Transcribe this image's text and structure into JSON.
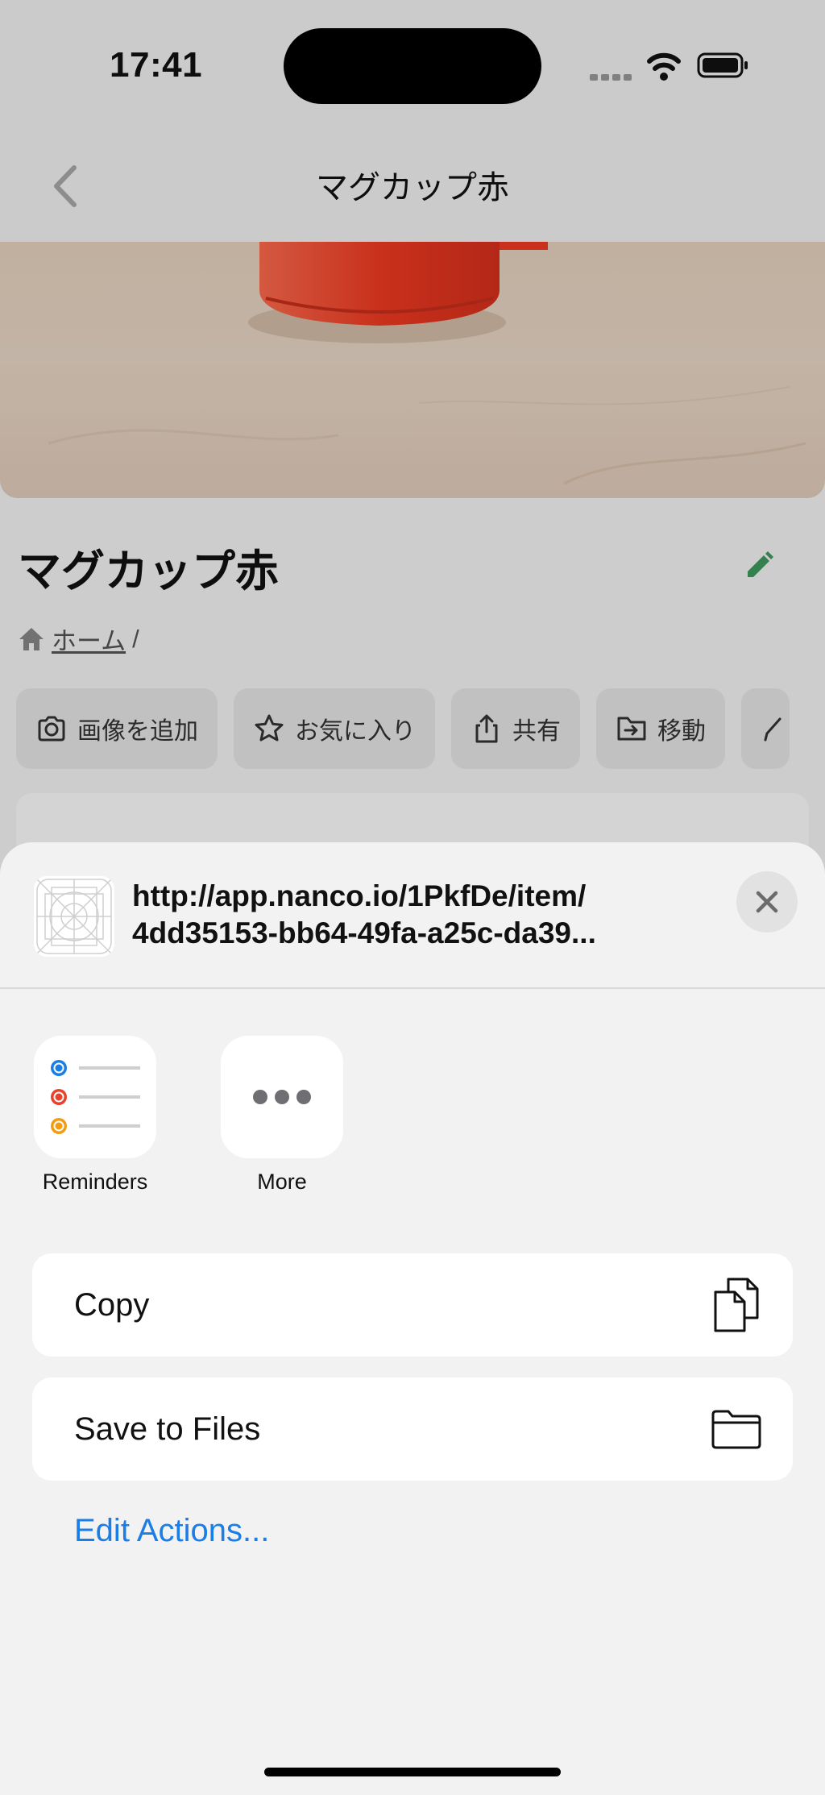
{
  "status_bar": {
    "time": "17:41"
  },
  "nav": {
    "title": "マグカップ赤"
  },
  "item": {
    "title": "マグカップ赤",
    "breadcrumb_home": "ホーム",
    "breadcrumb_sep": "/"
  },
  "actions": [
    {
      "label": "画像を追加",
      "icon": "camera-icon"
    },
    {
      "label": "お気に入り",
      "icon": "star-icon"
    },
    {
      "label": "共有",
      "icon": "share-icon"
    },
    {
      "label": "移動",
      "icon": "move-icon"
    }
  ],
  "share_sheet": {
    "url_line1": "http://app.nanco.io/1PkfDe/item/",
    "url_line2": "4dd35153-bb64-49fa-a25c-da39...",
    "apps": [
      {
        "label": "Reminders",
        "icon": "reminders-icon"
      },
      {
        "label": "More",
        "icon": "more-icon"
      }
    ],
    "copy_label": "Copy",
    "save_label": "Save to Files",
    "edit_actions_label": "Edit Actions..."
  },
  "colors": {
    "accent_blue": "#1a7ee6",
    "edit_green": "#3f9a5e",
    "mug_red": "#f23b22",
    "reminder_blue": "#1a7ee6",
    "reminder_red": "#e8412c",
    "reminder_orange": "#f39c12"
  }
}
